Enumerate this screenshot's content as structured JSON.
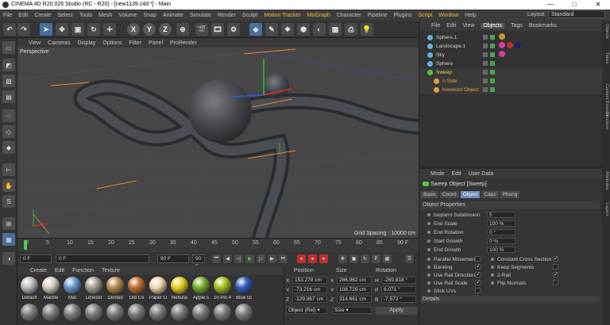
{
  "window": {
    "title": "CINEMA 4D R20.026 Studio (RC - R20) - [new1139.c4d *] - Main",
    "min": "—",
    "max": "□",
    "close": "✕"
  },
  "menubar": {
    "items": [
      "File",
      "Edit",
      "Create",
      "Select",
      "Tools",
      "Mesh",
      "Volume",
      "Snap",
      "Animate",
      "Simulate",
      "Render",
      "Sculpt",
      "Motion Tracker",
      "MoGraph",
      "Character",
      "Pipeline",
      "Plugins",
      "Script",
      "Window",
      "Help"
    ],
    "highlight": [
      "Motion Tracker",
      "MoGraph",
      "Script",
      "Window"
    ],
    "layout_label": "Layout:",
    "layout_value": "Standard"
  },
  "toolbar": {
    "axes": [
      "X",
      "Y",
      "Z"
    ]
  },
  "viewport": {
    "menu": [
      "View",
      "Cameras",
      "Display",
      "Options",
      "Filter",
      "Panel",
      "ProRender"
    ],
    "label": "Perspective",
    "grid_spacing": "Grid Spacing : 10000 cm"
  },
  "timeline": {
    "ticks": [
      "0",
      "5",
      "10",
      "15",
      "20",
      "25",
      "30",
      "35",
      "40",
      "45",
      "50",
      "55",
      "60",
      "65",
      "70",
      "75",
      "80",
      "85",
      "90"
    ],
    "end_label": "0 F"
  },
  "playback": {
    "current": "0 F",
    "start": "0 F",
    "end": "90 F",
    "end2": "90 F"
  },
  "materials": {
    "menu": [
      "Create",
      "Edit",
      "Function",
      "Texture"
    ],
    "items": [
      {
        "name": "Default",
        "color": "#bdbdbd"
      },
      {
        "name": "Marble",
        "color": "#d8d0c0"
      },
      {
        "name": "Mat",
        "color": "#6a9ad0"
      },
      {
        "name": "Limesto",
        "color": "#a8a090"
      },
      {
        "name": "Dented",
        "color": "#b89050"
      },
      {
        "name": "Old Co",
        "color": "#c07030"
      },
      {
        "name": "Paper Li",
        "color": "#f0d8b0"
      },
      {
        "name": "Nebulai",
        "color": "#e8d020"
      },
      {
        "name": "Apple s",
        "color": "#7ab030"
      },
      {
        "name": "10 Pin 4",
        "color": "#a8c020"
      },
      {
        "name": "Blue Gl",
        "color": "#3060c0"
      }
    ]
  },
  "coords": {
    "headers": {
      "position": "Position",
      "size": "Size",
      "rotation": "Rotation"
    },
    "rows": [
      {
        "axis": "X",
        "pos": "153.278 cm",
        "size_axis": "X",
        "size": "286.962 cm",
        "rot_axis": "H",
        "rot": "-269.818 °"
      },
      {
        "axis": "Y",
        "pos": "-73.216 cm",
        "size_axis": "Y",
        "size": "108.729 cm",
        "rot_axis": "P",
        "rot": "6.071 °"
      },
      {
        "axis": "Z",
        "pos": "-129.867 cm",
        "size_axis": "Z",
        "size": "314.661 cm",
        "rot_axis": "B",
        "rot": "-7.572 °"
      }
    ],
    "mode1": "Object (Rel) ▾",
    "mode2": "Size ▾",
    "apply": "Apply"
  },
  "objects": {
    "menu": [
      "File",
      "Edit",
      "View",
      "Objects",
      "Tags",
      "Bookmarks"
    ],
    "active_tab": "Objects",
    "items": [
      {
        "name": "Sphere.1",
        "indent": 0,
        "color": "#6ab0e0",
        "hl": false
      },
      {
        "name": "Landscape.1",
        "indent": 0,
        "color": "#6ab0e0",
        "hl": false
      },
      {
        "name": "Sky",
        "indent": 0,
        "color": "#6ab0e0",
        "hl": false
      },
      {
        "name": "Sphere",
        "indent": 0,
        "color": "#6ab0e0",
        "hl": false
      },
      {
        "name": "Sweep",
        "indent": 0,
        "color": "#60c040",
        "hl": true
      },
      {
        "name": "n-Side",
        "indent": 1,
        "color": "#e0a040",
        "hl": true
      },
      {
        "name": "Newknot Object",
        "indent": 1,
        "color": "#e0a040",
        "hl": true
      }
    ]
  },
  "rightstrip": [
    "Objects",
    "Takes",
    "Content Browser",
    "Structure",
    "Attributes",
    "Layers"
  ],
  "attributes": {
    "menu": [
      "Mode",
      "Edit",
      "User Data"
    ],
    "title": "Sweep Object [Sweep]",
    "tabs": [
      "Basic",
      "Coord",
      "Object",
      "Caps",
      "Phong"
    ],
    "active_tab": "Object",
    "section": "Object Properties",
    "props": [
      {
        "label": "Isoparm Subdivision",
        "value": "5"
      },
      {
        "label": "End Scale",
        "value": "100 %"
      },
      {
        "label": "End Rotation",
        "value": "0 °"
      },
      {
        "label": "Start Growth",
        "value": "0 %"
      },
      {
        "label": "End Growth",
        "value": "100 %"
      }
    ],
    "checks_left": [
      {
        "label": "Parallel Movement",
        "checked": false
      },
      {
        "label": "Banking",
        "checked": true
      },
      {
        "label": "Use Rail Direction",
        "checked": true
      },
      {
        "label": "Use Rail Scale",
        "checked": true
      },
      {
        "label": "Stick UVs",
        "checked": false
      }
    ],
    "checks_right": [
      {
        "label": "Constant Cross Section",
        "checked": true
      },
      {
        "label": "Keep Segments",
        "checked": false
      },
      {
        "label": "2-Rail",
        "checked": true
      },
      {
        "label": "Flip Normals",
        "checked": false
      }
    ],
    "details": "Details"
  }
}
